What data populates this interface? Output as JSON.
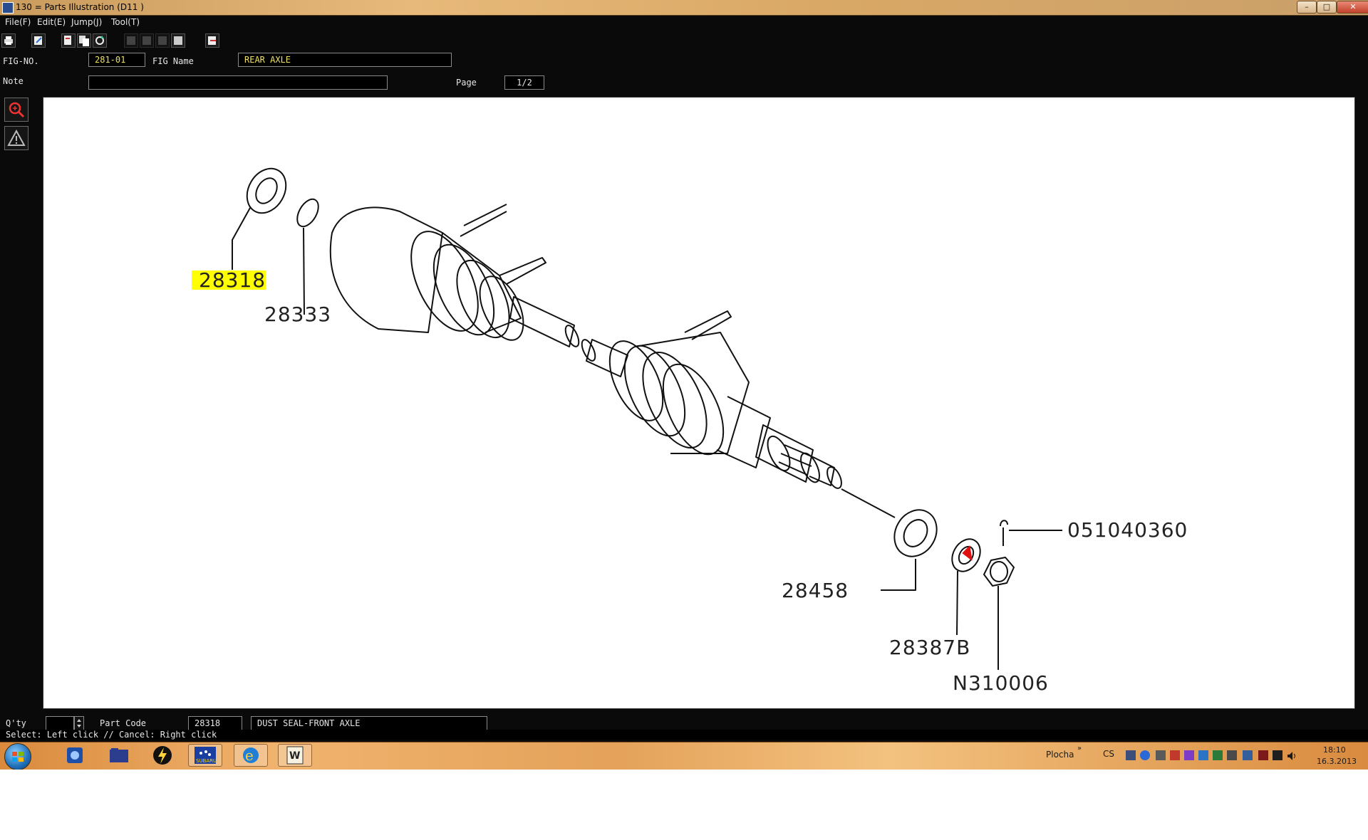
{
  "window": {
    "title": "130 = Parts Illustration (D11   )"
  },
  "menu": [
    "File(F)",
    "Edit(E)",
    "Jump(J)",
    "Tool(T)"
  ],
  "header": {
    "fig_no_label": "FIG-NO.",
    "fig_no_value": "281-01",
    "fig_name_label": "FIG Name",
    "fig_name_value": "REAR AXLE",
    "note_label": "Note",
    "note_value": "",
    "page_label": "Page",
    "page_value": "1/2"
  },
  "callouts": {
    "highlighted": "28318",
    "c1": "28333",
    "c2": "051040360",
    "c3": "28458",
    "c4": "28387B",
    "c5": "N310006"
  },
  "bottom": {
    "qty_label": "Q'ty",
    "qty_value": "",
    "part_code_label": "Part Code",
    "part_code_value": "28318",
    "part_name_value": "DUST SEAL-FRONT AXLE",
    "status_text": "Select: Left click // Cancel: Right click"
  },
  "taskbar": {
    "desktop_label": "Plocha",
    "lang": "CS",
    "time": "18:10",
    "date": "16.3.2013",
    "subaru_label": "SUBARU"
  },
  "colors": {
    "highlight": "#ffff00",
    "field_text": "#f0e060",
    "taskbar": "#e4a25a"
  }
}
